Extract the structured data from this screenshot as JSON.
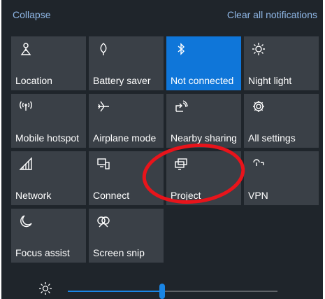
{
  "header": {
    "collapse_label": "Collapse",
    "clear_label": "Clear all notifications"
  },
  "tiles": [
    {
      "label": "Location",
      "icon": "location-icon",
      "active": false
    },
    {
      "label": "Battery saver",
      "icon": "battery-saver-icon",
      "active": false
    },
    {
      "label": "Not connected",
      "icon": "bluetooth-icon",
      "active": true
    },
    {
      "label": "Night light",
      "icon": "night-light-icon",
      "active": false
    },
    {
      "label": "Mobile hotspot",
      "icon": "mobile-hotspot-icon",
      "active": false
    },
    {
      "label": "Airplane mode",
      "icon": "airplane-icon",
      "active": false
    },
    {
      "label": "Nearby sharing",
      "icon": "nearby-sharing-icon",
      "active": false
    },
    {
      "label": "All settings",
      "icon": "gear-icon",
      "active": false
    },
    {
      "label": "Network",
      "icon": "network-icon",
      "active": false
    },
    {
      "label": "Connect",
      "icon": "connect-icon",
      "active": false
    },
    {
      "label": "Project",
      "icon": "project-icon",
      "active": false
    },
    {
      "label": "VPN",
      "icon": "vpn-icon",
      "active": false
    },
    {
      "label": "Focus assist",
      "icon": "moon-icon",
      "active": false
    },
    {
      "label": "Screen snip",
      "icon": "screen-snip-icon",
      "active": false
    }
  ],
  "brightness": {
    "icon": "sun-icon",
    "level": 0.45
  },
  "colors": {
    "panel_bg": "#1f252b",
    "tile_bg": "#3a4047",
    "active_tile_bg": "#0f76d9",
    "link": "#8fb7e6",
    "accent": "#1a86e6",
    "annotation_red": "#e8141b"
  }
}
